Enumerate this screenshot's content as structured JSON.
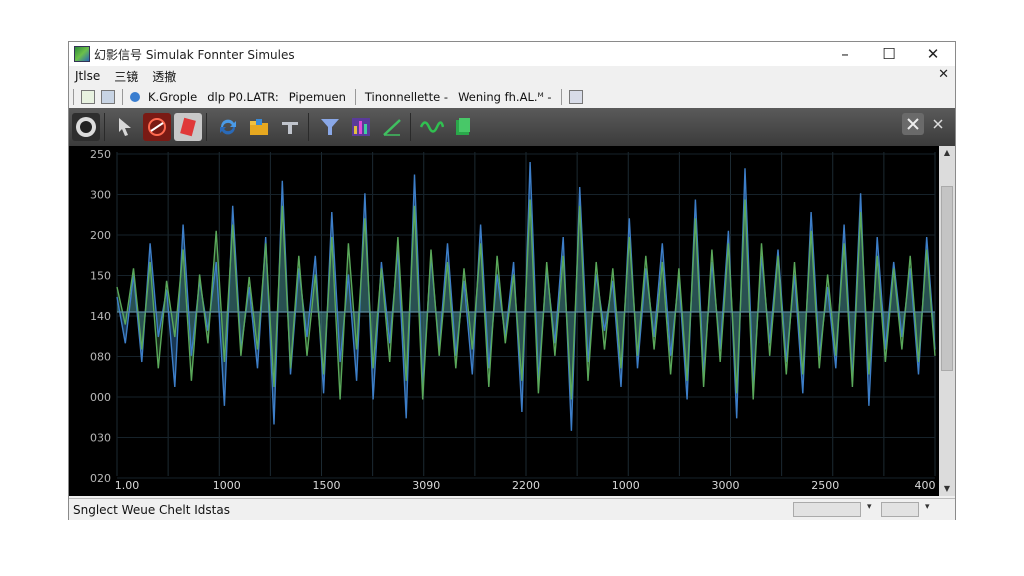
{
  "window": {
    "title": "幻影信号 Simulak Fonnter Simules",
    "controls": {
      "minimize": "–",
      "maximize": "☐",
      "close": "✕"
    }
  },
  "menubar": {
    "items": [
      "Jtlse",
      "三镜",
      "透撤"
    ],
    "close": "✕"
  },
  "toolbar1": {
    "items": [
      "K.Grople",
      "dlp P0.LATR:",
      "Pipemuen",
      "Tinonnellette -",
      "Wening fh.AL.ᴹ -"
    ]
  },
  "toolbar2": {
    "tools": [
      {
        "name": "record-icon",
        "color": "#1a1a1a"
      },
      {
        "name": "pointer-icon",
        "color": "#cfcfcf"
      },
      {
        "name": "signal-icon",
        "color": "#d23a2a"
      },
      {
        "name": "edit-icon",
        "color": "#e04040"
      },
      {
        "name": "refresh-icon",
        "color": "#3a8ad6"
      },
      {
        "name": "folder-icon",
        "color": "#e0a020"
      },
      {
        "name": "probe-icon",
        "color": "#9aa0a8"
      },
      {
        "name": "filter-icon",
        "color": "#7a9ad8"
      },
      {
        "name": "spectrum-icon",
        "color": "#c04ad8"
      },
      {
        "name": "ramp-icon",
        "color": "#40c060"
      },
      {
        "name": "waveform-icon",
        "color": "#2ab050"
      },
      {
        "name": "export-icon",
        "color": "#20a040"
      }
    ]
  },
  "chart_data": {
    "type": "line",
    "title": "",
    "xlabel": "",
    "ylabel": "",
    "x_tick_labels": [
      "1.00",
      "1000",
      "1500",
      "3090",
      "2200",
      "1000",
      "3000",
      "2500",
      "400"
    ],
    "y_tick_labels": [
      "250",
      "300",
      "200",
      "150",
      "140",
      "080",
      "000",
      "030",
      "020"
    ],
    "baseline_label": "140",
    "series": [
      {
        "color": "#3d7ec8",
        "fill": "rgba(45,100,150,0.55)",
        "values": [
          12,
          -25,
          30,
          -40,
          55,
          -20,
          18,
          -60,
          70,
          -35,
          25,
          -15,
          40,
          -75,
          85,
          -30,
          20,
          -45,
          60,
          -90,
          105,
          -50,
          35,
          -20,
          45,
          -65,
          80,
          -40,
          30,
          -55,
          95,
          -70,
          40,
          -25,
          50,
          -85,
          110,
          -60,
          45,
          -30,
          55,
          -35,
          25,
          -50,
          70,
          -45,
          30,
          -20,
          40,
          -80,
          120,
          -55,
          35,
          -25,
          60,
          -95,
          100,
          -40,
          30,
          -15,
          25,
          -60,
          75,
          -45,
          35,
          -20,
          55,
          -35,
          28,
          -70,
          90,
          -50,
          40,
          -30,
          65,
          -85,
          115,
          -60,
          45,
          -25,
          50,
          -40,
          30,
          -65,
          80,
          -35,
          20,
          -45,
          70,
          -55,
          95,
          -75,
          60,
          -30,
          40,
          -20,
          35,
          -50,
          60,
          -30
        ]
      },
      {
        "color": "#5aa85a",
        "fill": "rgba(70,130,80,0.35)",
        "values": [
          20,
          -10,
          35,
          -30,
          40,
          -45,
          25,
          -20,
          50,
          -55,
          30,
          -25,
          65,
          -40,
          70,
          -35,
          28,
          -30,
          55,
          -60,
          85,
          -45,
          45,
          -35,
          30,
          -50,
          60,
          -70,
          55,
          -30,
          75,
          -45,
          35,
          -40,
          60,
          -55,
          85,
          -70,
          50,
          -35,
          40,
          -45,
          35,
          -30,
          55,
          -60,
          45,
          -25,
          30,
          -55,
          90,
          -65,
          40,
          -35,
          45,
          -70,
          85,
          -55,
          40,
          -30,
          35,
          -45,
          60,
          -35,
          45,
          -30,
          40,
          -50,
          35,
          -55,
          75,
          -60,
          50,
          -40,
          55,
          -65,
          90,
          -70,
          55,
          -35,
          45,
          -50,
          40,
          -50,
          65,
          -45,
          30,
          -35,
          55,
          -60,
          80,
          -50,
          45,
          -40,
          35,
          -30,
          45,
          -40,
          50,
          -35
        ]
      }
    ],
    "grid": true,
    "legend": "none",
    "background": "#000000"
  },
  "statusbar": {
    "text": "Snglect Weue Chelt Idstas",
    "drop1": "▾",
    "drop2": "▾"
  }
}
